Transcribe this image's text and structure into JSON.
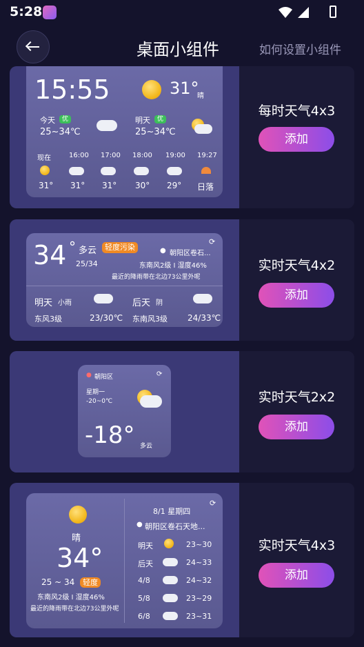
{
  "status": {
    "time": "5:28"
  },
  "header": {
    "title": "桌面小组件",
    "help": "如何设置小组件"
  },
  "widgets": [
    {
      "name": "每时天气4x3",
      "add": "添加",
      "card": {
        "time": "15:55",
        "temp": "31°",
        "cond": "晴",
        "today": {
          "label": "今天",
          "badge": "优",
          "range": "25~34℃"
        },
        "tomorrow": {
          "label": "明天",
          "badge": "优",
          "range": "25~34℃"
        },
        "hours": [
          {
            "t": "现在",
            "v": "31°"
          },
          {
            "t": "16:00",
            "v": "31°"
          },
          {
            "t": "17:00",
            "v": "31°"
          },
          {
            "t": "18:00",
            "v": "30°"
          },
          {
            "t": "19:00",
            "v": "29°"
          },
          {
            "t": "19:27",
            "v": "日落"
          }
        ]
      }
    },
    {
      "name": "实时天气4x2",
      "add": "添加",
      "card": {
        "temp": "34",
        "deg": "°",
        "cond": "多云",
        "aqi": "轻度污染",
        "range": "25/34",
        "loc": "朝阳区卷石...",
        "wind": "东南风2级 I 湿度46%",
        "rain": "最近的降雨带在北边73公里外呢",
        "d1": {
          "label": "明天",
          "cond": "小雨",
          "wind": "东风3级",
          "range": "23/30℃"
        },
        "d2": {
          "label": "后天",
          "cond": "阴",
          "wind": "东南风3级",
          "range": "24/33℃"
        }
      }
    },
    {
      "name": "实时天气2x2",
      "add": "添加",
      "card": {
        "loc": "朝阳区",
        "day": "星期一",
        "range": "-20~0℃",
        "temp": "-18°",
        "cond": "多云"
      }
    },
    {
      "name": "实时天气4x3",
      "add": "添加",
      "card": {
        "cond": "晴",
        "temp": "34°",
        "range": "25 ~ 34",
        "aqi": "轻度",
        "wind": "东南风2级 I 湿度46%",
        "rain": "最近的降雨带在北边73公里外呢",
        "date": "8/1 星期四",
        "loc": "朝阳区卷石天地...",
        "days": [
          {
            "d": "明天",
            "r": "23~30"
          },
          {
            "d": "后天",
            "r": "24~33"
          },
          {
            "d": "4/8",
            "r": "24~32"
          },
          {
            "d": "5/8",
            "r": "23~29"
          },
          {
            "d": "6/8",
            "r": "23~31"
          }
        ]
      }
    }
  ]
}
